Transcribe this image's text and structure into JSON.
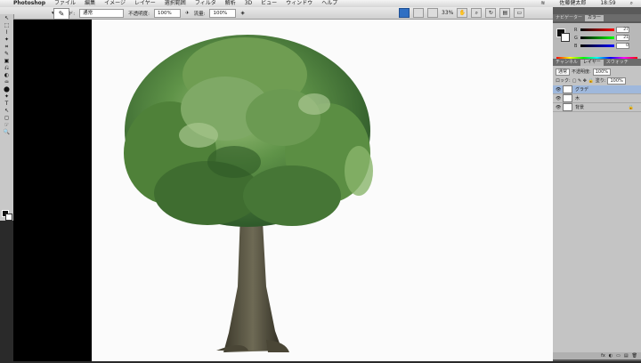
{
  "menubar": {
    "apple": "",
    "app_name": "Photoshop",
    "items": [
      "ファイル",
      "編集",
      "イメージ",
      "レイヤー",
      "選択範囲",
      "フィルタ",
      "解析",
      "3D",
      "ビュー",
      "ウィンドウ",
      "ヘルプ"
    ],
    "status": {
      "user": "佐藤健太郎",
      "time": "18:59",
      "wifi": "≋",
      "spotlight": "⌕"
    }
  },
  "options_bar": {
    "mode_label": "モード:",
    "mode_value": "通常",
    "opacity_label": "不透明度:",
    "opacity_value": "100%",
    "flow_label": "流量:",
    "flow_value": "100%"
  },
  "appbar": {
    "zoom_value": "33%"
  },
  "tools": [
    "↖",
    "⬚",
    "⌇",
    "✦",
    "⌗",
    "✎",
    "▣",
    "⎌",
    "◐",
    "♒",
    "⬤",
    "✦",
    "T",
    "↖",
    "◻",
    "☞",
    "🔍"
  ],
  "panels": {
    "top_tabs": [
      "ナビゲーター",
      "カラー"
    ],
    "color_sliders": [
      {
        "label": "R",
        "value": "27"
      },
      {
        "label": "G",
        "value": "21"
      },
      {
        "label": "B",
        "value": "0"
      }
    ],
    "mid_tabs": [
      "チャンネル",
      "レイヤー",
      "スウォッチ"
    ],
    "blend_mode": "通常",
    "opacity_label": "不透明度:",
    "opacity_value": "100%",
    "lock_label": "ロック:",
    "fill_label": "塗り:",
    "fill_value": "100%",
    "layers": [
      {
        "name": "グラデ",
        "selected": true
      },
      {
        "name": "木",
        "selected": false
      },
      {
        "name": "背景",
        "selected": false
      }
    ],
    "footer_icons": [
      "fx",
      "◐",
      "▭",
      "▤",
      "🗑"
    ]
  }
}
